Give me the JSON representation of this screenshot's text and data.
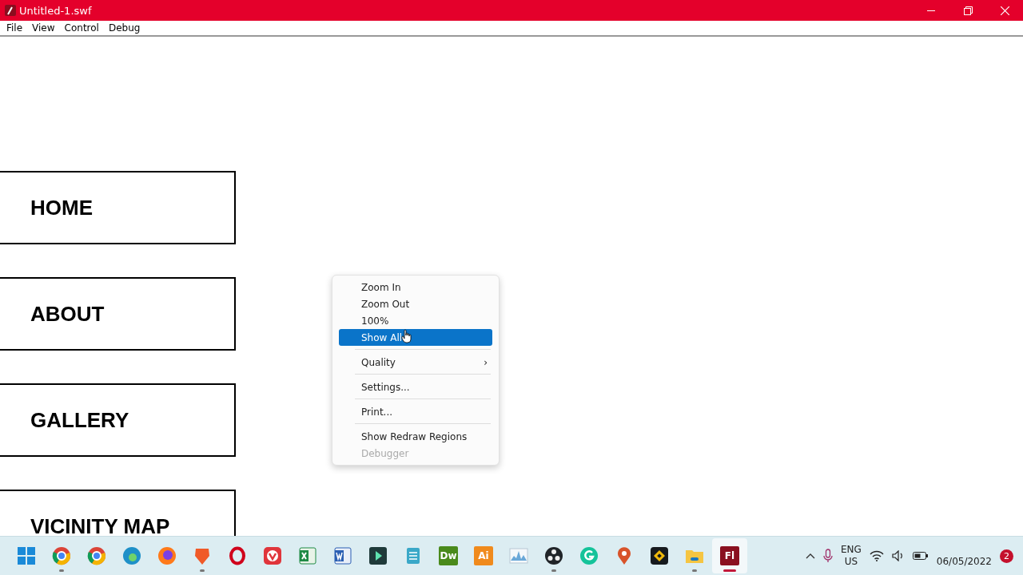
{
  "window": {
    "title": "Untitled-1.swf"
  },
  "menu_bar": [
    "File",
    "View",
    "Control",
    "Debug"
  ],
  "stage_buttons": [
    "HOME",
    "ABOUT",
    "GALLERY",
    "VICINITY MAP"
  ],
  "context_menu": [
    {
      "label": "Zoom In",
      "selected": false,
      "disabled": false,
      "separator_before": false
    },
    {
      "label": "Zoom Out",
      "selected": false,
      "disabled": false,
      "separator_before": false
    },
    {
      "label": "100%",
      "selected": false,
      "disabled": false,
      "separator_before": false
    },
    {
      "label": "Show All",
      "selected": true,
      "disabled": false,
      "separator_before": false
    },
    {
      "label": "Quality",
      "selected": false,
      "disabled": false,
      "separator_before": true,
      "arrow": "›"
    },
    {
      "label": "Settings...",
      "selected": false,
      "disabled": false,
      "separator_before": true
    },
    {
      "label": "Print...",
      "selected": false,
      "disabled": false,
      "separator_before": true
    },
    {
      "label": "Show Redraw Regions",
      "selected": false,
      "disabled": false,
      "separator_before": true
    },
    {
      "label": "Debugger",
      "selected": false,
      "disabled": true,
      "separator_before": false
    }
  ],
  "taskbar": {
    "apps": [
      {
        "kind": "start",
        "running": false,
        "selected": false
      },
      {
        "kind": "ring",
        "running": true,
        "selected": false
      },
      {
        "kind": "ring",
        "running": false,
        "selected": false
      },
      {
        "kind": "swirl",
        "running": false,
        "selected": false
      },
      {
        "kind": "fox",
        "running": false,
        "selected": false
      },
      {
        "kind": "shield",
        "running": true,
        "selected": false
      },
      {
        "kind": "o",
        "running": false,
        "selected": false
      },
      {
        "kind": "v",
        "running": false,
        "selected": false
      },
      {
        "kind": "sheet",
        "running": false,
        "selected": false
      },
      {
        "kind": "doc",
        "running": false,
        "selected": false
      },
      {
        "kind": "play",
        "running": false,
        "selected": false
      },
      {
        "kind": "notepad",
        "running": false,
        "selected": false
      },
      {
        "kind": "label",
        "color": "#4a8a1c",
        "text": "Dw",
        "running": false,
        "selected": false
      },
      {
        "kind": "label",
        "color": "#f08a1c",
        "text": "Ai",
        "running": false,
        "selected": false
      },
      {
        "kind": "chart",
        "running": false,
        "selected": false
      },
      {
        "kind": "aperture",
        "running": true,
        "selected": false
      },
      {
        "kind": "g",
        "running": false,
        "selected": false
      },
      {
        "kind": "pin",
        "running": false,
        "selected": false
      },
      {
        "kind": "diamond",
        "running": false,
        "selected": false
      },
      {
        "kind": "folder",
        "running": true,
        "selected": false
      },
      {
        "kind": "label",
        "color": "#8a1020",
        "text": "Fl",
        "running": true,
        "selected": true
      }
    ],
    "language": [
      "ENG",
      "US"
    ],
    "date": "06/05/2022",
    "badge": "2"
  }
}
